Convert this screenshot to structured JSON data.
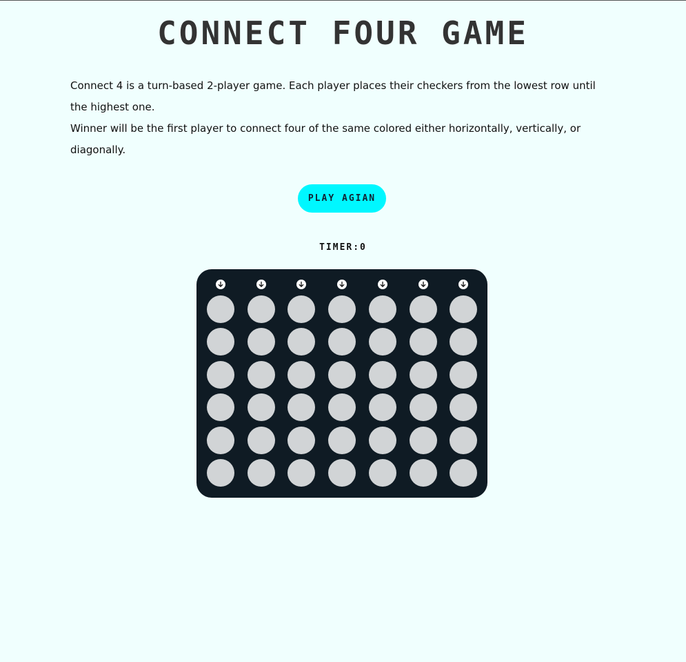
{
  "title": "CONNECT FOUR GAME",
  "description": {
    "line1": "Connect 4 is a turn-based 2-player game. Each player places their checkers from the lowest row until the highest one.",
    "line2": "Winner will be the first player to connect four of the same colored either horizontally, vertically, or diagonally."
  },
  "controls": {
    "play_again_label": "PLAY AGIAN",
    "timer_text": "TIMER:0"
  },
  "board": {
    "columns": 7,
    "rows": 6,
    "drop_icon": "arrow-down-circle-icon",
    "board_color": "#0f1b24",
    "empty_cell_color": "#d1d4d6"
  },
  "colors": {
    "background": "#f0fffe",
    "button": "#00f7ff"
  }
}
